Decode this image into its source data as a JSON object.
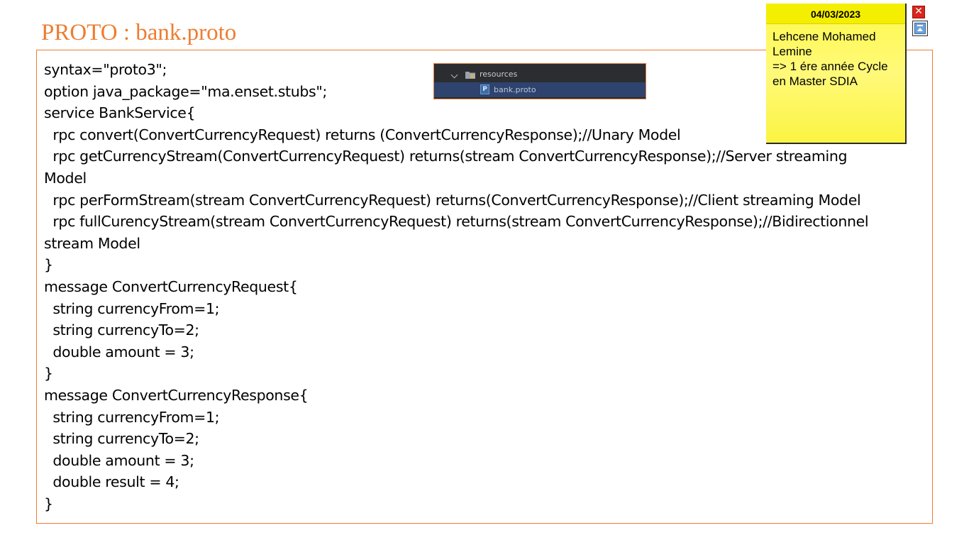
{
  "slide": {
    "title": "PROTO : bank.proto"
  },
  "code": {
    "lines": [
      "syntax=\"proto3\";",
      "option java_package=\"ma.enset.stubs\";",
      "service BankService{",
      "  rpc convert(ConvertCurrencyRequest) returns (ConvertCurrencyResponse);//Unary Model",
      "  rpc getCurrencyStream(ConvertCurrencyRequest) returns(stream ConvertCurrencyResponse);//Server streaming",
      "Model",
      "  rpc perFormStream(stream ConvertCurrencyRequest) returns(ConvertCurrencyResponse);//Client streaming Model",
      "  rpc fullCurencyStream(stream ConvertCurrencyRequest) returns(stream ConvertCurrencyResponse);//Bidirectionnel",
      "stream Model",
      "}",
      "message ConvertCurrencyRequest{",
      "  string currencyFrom=1;",
      "  string currencyTo=2;",
      "  double amount = 3;",
      "}",
      "message ConvertCurrencyResponse{",
      "  string currencyFrom=1;",
      "  string currencyTo=2;",
      "  double amount = 3;",
      "  double result = 4;",
      "}"
    ]
  },
  "project_tree": {
    "folder_label": "resources",
    "file_label": "bank.proto",
    "file_icon_letter": "P",
    "folder_icon": "folder-icon",
    "file_icon": "proto-file-icon",
    "colors": {
      "background": "#2b2d30",
      "selection": "#2e436e"
    }
  },
  "sticky_note": {
    "date": "04/03/2023",
    "lines": [
      "Lehcene Mohamed",
      "Lemine",
      "=> 1 ére année Cycle",
      "en Master SDIA"
    ],
    "close_glyph": "✕",
    "colors": {
      "background": "#fff97a",
      "header": "#f4ee00"
    }
  },
  "theme": {
    "title_color": "#ed7d31",
    "border_color": "#ed7d31"
  }
}
